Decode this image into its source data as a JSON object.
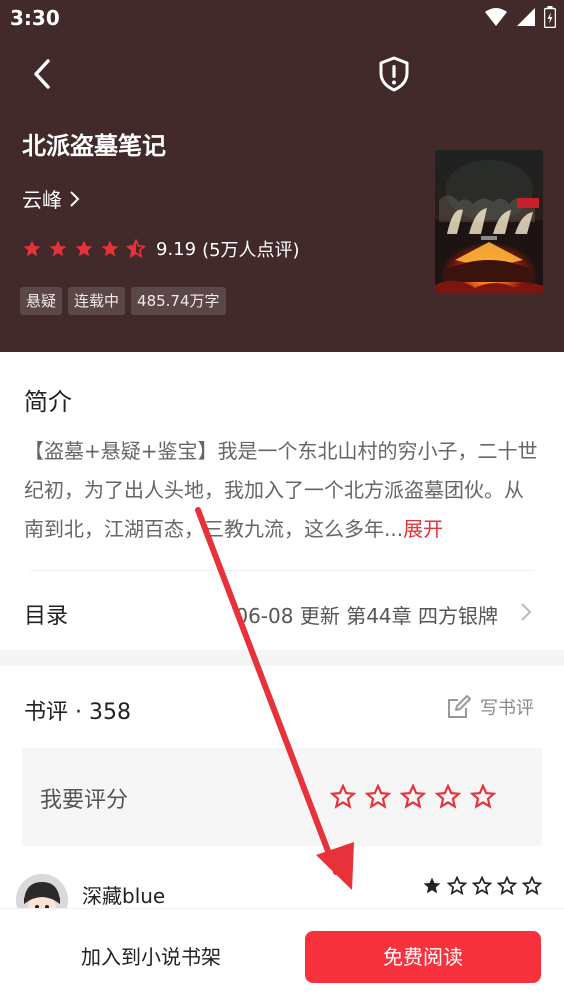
{
  "status_bar": {
    "time": "3:30"
  },
  "book": {
    "title": "北派盗墓笔记",
    "author": "云峰",
    "rating_score": "9.19",
    "rating_count": "(5万人点评)",
    "rating_stars": 4.5,
    "tags": [
      "悬疑",
      "连载中",
      "485.74万字"
    ]
  },
  "intro": {
    "title": "简介",
    "text": "【盗墓+悬疑+鉴宝】我是一个东北山村的穷小子，二十世纪初，为了出人头地，我加入了一个北方派盗墓团伙。从南到北，江湖百态，三教九流，这么多年...",
    "expand_label": "展开"
  },
  "toc": {
    "label": "目录",
    "latest": "06-08  更新  第44章 四方银牌"
  },
  "reviews": {
    "title": "书评 · 358",
    "write_label": "写书评",
    "rate_label": "我要评分",
    "items": [
      {
        "name": "深藏blue",
        "stars": 1
      }
    ]
  },
  "bottom": {
    "add_shelf_label": "加入到小说书架",
    "read_label": "免费阅读"
  },
  "colors": {
    "header_bg": "#42292a",
    "accent_red": "#f8323c",
    "star_red": "#e5323b"
  }
}
